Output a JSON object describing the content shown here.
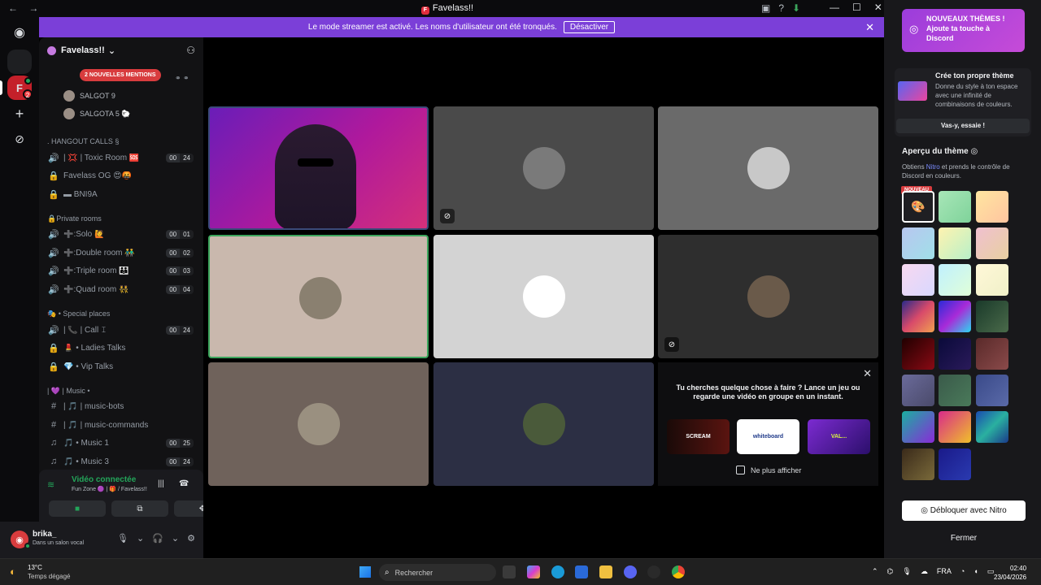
{
  "titlebar": {
    "back_icon": "←",
    "forward_icon": "→",
    "title": "Favelass!!",
    "logo_letter": "F"
  },
  "banner": {
    "message": "Le mode streamer est activé. Les noms d'utilisateur ont été tronqués.",
    "button_label": "Désactiver"
  },
  "server": {
    "name": "Favelass!!"
  },
  "sidebar": {
    "mentions_label": "2 NOUVELLES MENTIONS",
    "users": [
      "SALGOT 9",
      "SALGOTA 5 🐑"
    ],
    "categories": [
      ". HANGOUT CALLS §",
      "🔒Private rooms",
      "🎭 • Special places",
      "| 💜 | Music •"
    ],
    "channels": [
      {
        "name": "| 💢 | Toxic Room 🆘",
        "c1": "00",
        "c2": "24"
      },
      {
        "name": "Favelass OG 😍🤬",
        "c1": "",
        "c2": ""
      },
      {
        "name": "▬ BNI9A",
        "c1": "",
        "c2": ""
      },
      {
        "name": "➕:Solo 🙋",
        "c1": "00",
        "c2": "01"
      },
      {
        "name": "➕:Double room 👬",
        "c1": "00",
        "c2": "02"
      },
      {
        "name": "➕:Triple room 👪",
        "c1": "00",
        "c2": "03"
      },
      {
        "name": "➕:Quad room 👯",
        "c1": "00",
        "c2": "04"
      },
      {
        "name": "| 📞 | Call 𝙸",
        "c1": "00",
        "c2": "24"
      },
      {
        "name": "💄 • Ladies Talks",
        "c1": "",
        "c2": ""
      },
      {
        "name": "💎 • Vip Talks",
        "c1": "",
        "c2": ""
      },
      {
        "name": "| 🎵 | music-bots",
        "c1": "",
        "c2": ""
      },
      {
        "name": "| 🎵 | music-commands",
        "c1": "",
        "c2": ""
      },
      {
        "name": "🎵 • Music 1",
        "c1": "00",
        "c2": "25"
      },
      {
        "name": "🎵 • Music 3",
        "c1": "00",
        "c2": "24"
      }
    ]
  },
  "voice": {
    "title": "Vidéo connectée",
    "subtitle": "Fun Zone 🟣 | 🎁 / Favelass!!"
  },
  "user": {
    "name": "brika_",
    "status": "Dans un salon vocal"
  },
  "activity": {
    "prompt": "Tu cherches quelque chose à faire ? Lance un jeu ou regarde une vidéo en groupe en un instant.",
    "cards": [
      "SCREAM",
      "whiteboard",
      "VAL..."
    ],
    "checkbox_label": "Ne plus afficher"
  },
  "theme_panel": {
    "promo": "NOUVEAUX THÈMES ! Ajoute ta touche à Discord",
    "create_title": "Crée ton propre thème",
    "create_desc": "Donne du style à ton espace avec une infinité de combinaisons de couleurs.",
    "create_button": "Vas-y, essaie !",
    "preview_title": "Aperçu du thème",
    "preview_desc_pre": "Obtiens ",
    "preview_desc_nitro": "Nitro",
    "preview_desc_post": " et prends le contrôle de Discord en couleurs.",
    "new_tag": "NOUVEAU",
    "unlock_button": "Débloquer avec Nitro",
    "close_button": "Fermer",
    "swatches": [
      "#1f1f23",
      "linear-gradient(135deg,#a8e6b8,#7fd39a)",
      "linear-gradient(135deg,#ffe6a0,#ffc4a0)",
      "linear-gradient(135deg,#b8c6f0,#a0e0e8)",
      "linear-gradient(135deg,#fff3b0,#b8f0c8)",
      "linear-gradient(135deg,#f0c0d0,#e8d0a0)",
      "linear-gradient(135deg,#f8d8f0,#d8d8ff)",
      "linear-gradient(135deg,#c0f0ff,#e0ffd8)",
      "linear-gradient(135deg,#fff8d8,#f0f0c8)",
      "linear-gradient(135deg,#2a2a8a,#d84a6a,#f0a050)",
      "linear-gradient(135deg,#2b2bd8,#a82bd8,#2bd8f0)",
      "linear-gradient(135deg,#1a3a2a,#4a6a4a)",
      "linear-gradient(135deg,#200000,#8a0a14)",
      "linear-gradient(135deg,#0a0a3a,#2a1a5a)",
      "linear-gradient(135deg,#5a2a2a,#8a4a4a)",
      "linear-gradient(135deg,#6a6a9a,#4a4a6a)",
      "linear-gradient(135deg,#3a5a4a,#4a7a5a)",
      "linear-gradient(135deg,#3a4a8a,#5a6aa8)",
      "linear-gradient(135deg,#1ab0a0,#8a2ad8)",
      "linear-gradient(135deg,#d82a8a,#f0c02a)",
      "linear-gradient(135deg,#1a4ab0,#2ab0a0,#1a3a8a)",
      "linear-gradient(135deg,#3a2a1a,#7a6a3a)",
      "linear-gradient(135deg,#1a1a8a,#2a3ab0)"
    ]
  },
  "taskbar": {
    "temperature": "13°C",
    "weather": "Temps dégagé",
    "search_placeholder": "Rechercher",
    "language": "FRA",
    "time": "02:40",
    "date": "23/04/2026"
  }
}
